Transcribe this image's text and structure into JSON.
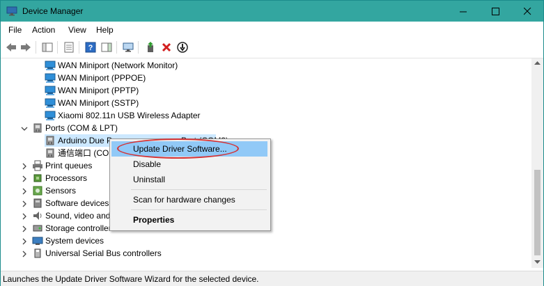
{
  "window": {
    "title": "Device Manager"
  },
  "menu": [
    "File",
    "Action",
    "View",
    "Help"
  ],
  "tree": {
    "network_items": [
      "WAN Miniport (Network Monitor)",
      "WAN Miniport (PPPOE)",
      "WAN Miniport (PPTP)",
      "WAN Miniport (SSTP)",
      "Xiaomi 802.11n USB Wireless Adapter"
    ],
    "ports_category": "Ports (COM & LPT)",
    "ports_children": [
      {
        "left": "Arduino Due P",
        "right": "Port (COM3)"
      },
      {
        "left": "通信端口 (CO",
        "right": ""
      }
    ],
    "categories": [
      "Print queues",
      "Processors",
      "Sensors",
      "Software devices",
      "Sound, video and",
      "Storage controllers",
      "System devices",
      "Universal Serial Bus controllers"
    ]
  },
  "context_menu": {
    "items": [
      "Update Driver Software...",
      "Disable",
      "Uninstall",
      "Scan for hardware changes",
      "Properties"
    ]
  },
  "status": {
    "text": "Launches the Update Driver Software Wizard for the selected device."
  },
  "colors": {
    "titlebar": "#33a6a0",
    "highlight": "#91c9f7",
    "annotation": "#d43234"
  }
}
